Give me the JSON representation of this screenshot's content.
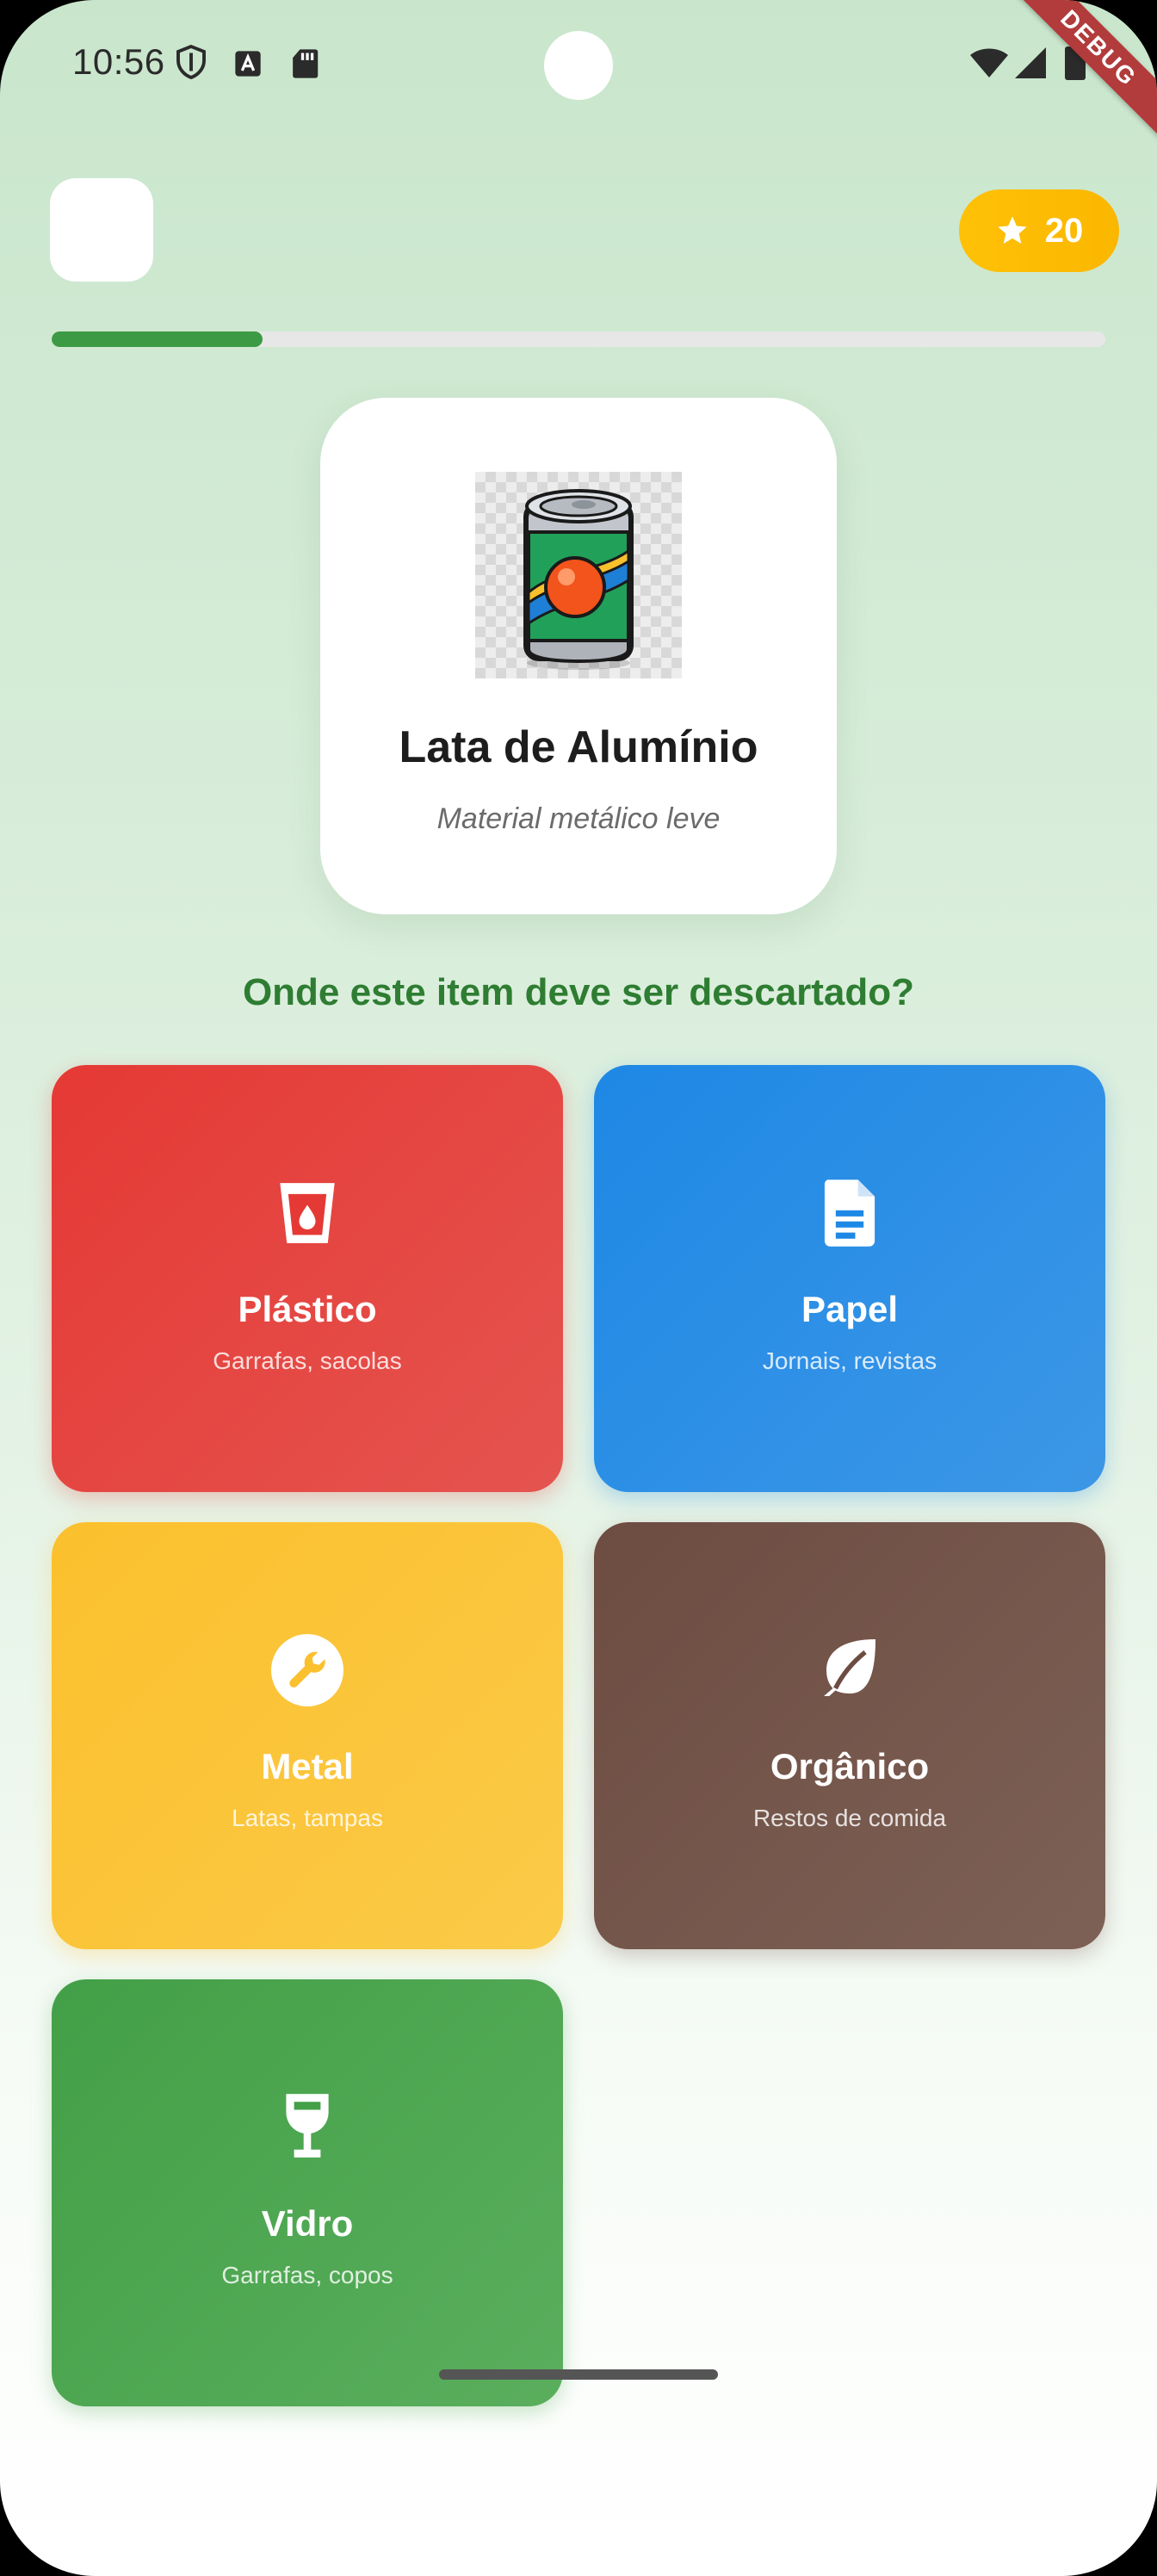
{
  "status_bar": {
    "time": "10:56",
    "left_icons": [
      "shield-icon",
      "font-download-icon",
      "sd-card-icon"
    ],
    "right_icons": [
      "wifi-icon",
      "cellular-signal-icon",
      "battery-icon"
    ],
    "debug_banner": "DEBUG"
  },
  "header": {
    "score_icon": "star-icon",
    "score": "20"
  },
  "progress": {
    "fraction": 0.2
  },
  "item": {
    "image_icon": "aluminum-can-image",
    "title": "Lata de Alumínio",
    "subtitle": "Material metálico leve"
  },
  "question": "Onde este item deve ser descartado?",
  "categories": [
    {
      "title": "Plástico",
      "description": "Garrafas, sacolas",
      "icon": "cup-drop-icon",
      "color": "#e53935"
    },
    {
      "title": "Papel",
      "description": "Jornais, revistas",
      "icon": "document-icon",
      "color": "#1e88e5"
    },
    {
      "title": "Metal",
      "description": "Latas, tampas",
      "icon": "wrench-icon",
      "color": "#fbc02d"
    },
    {
      "title": "Orgânico",
      "description": "Restos de comida",
      "icon": "leaf-icon",
      "color": "#6d4c41"
    },
    {
      "title": "Vidro",
      "description": "Garrafas, copos",
      "icon": "wine-glass-icon",
      "color": "#43a047"
    }
  ]
}
